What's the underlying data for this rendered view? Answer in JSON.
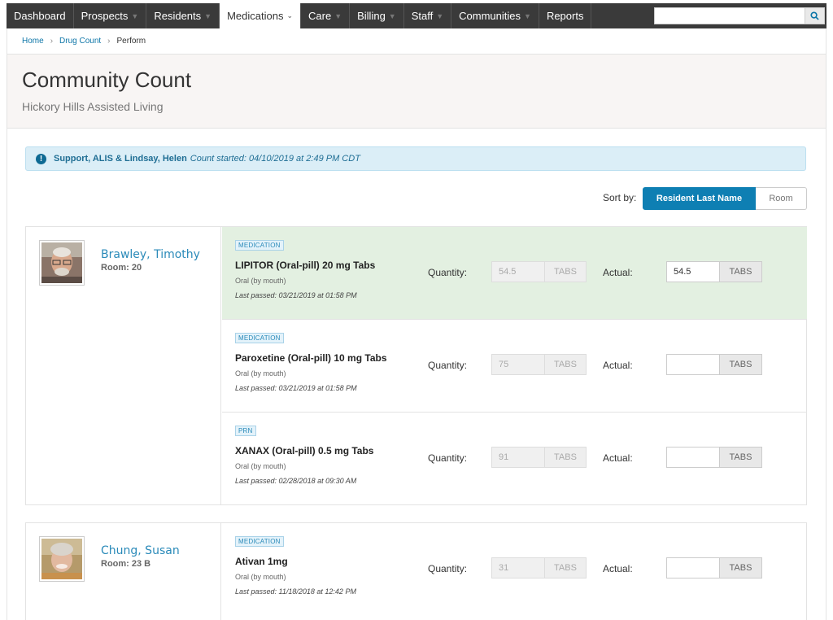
{
  "nav": {
    "items": [
      {
        "label": "Dashboard",
        "caret": false,
        "active": false
      },
      {
        "label": "Prospects",
        "caret": true,
        "active": false
      },
      {
        "label": "Residents",
        "caret": true,
        "active": false
      },
      {
        "label": "Medications",
        "caret": true,
        "active": true
      },
      {
        "label": "Care",
        "caret": true,
        "active": false
      },
      {
        "label": "Billing",
        "caret": true,
        "active": false
      },
      {
        "label": "Staff",
        "caret": true,
        "active": false
      },
      {
        "label": "Communities",
        "caret": true,
        "active": false
      },
      {
        "label": "Reports",
        "caret": false,
        "active": false
      }
    ],
    "search_placeholder": "",
    "search_icon": "search-icon"
  },
  "breadcrumb": {
    "home": "Home",
    "drug_count": "Drug Count",
    "current": "Perform"
  },
  "header": {
    "title": "Community Count",
    "subtitle": "Hickory Hills Assisted Living"
  },
  "alert": {
    "people": "Support, ALIS & Lindsay, Helen",
    "started": "Count started: 04/10/2019 at 2:49 PM CDT"
  },
  "sort": {
    "label": "Sort by:",
    "primary": "Resident Last Name",
    "secondary": "Room"
  },
  "labels": {
    "quantity": "Quantity:",
    "actual": "Actual:"
  },
  "residents": [
    {
      "name": "Brawley, Timothy",
      "room": "Room: 20",
      "meds": [
        {
          "tag": "MEDICATION",
          "name": "LIPITOR (Oral-pill) 20 mg Tabs",
          "route": "Oral (by mouth)",
          "last": "Last passed: 03/21/2019 at 01:58 PM",
          "qty": "54.5",
          "unit": "TABS",
          "actual": "54.5",
          "actual_unit": "TABS",
          "highlight": true
        },
        {
          "tag": "MEDICATION",
          "name": "Paroxetine (Oral-pill) 10 mg Tabs",
          "route": "Oral (by mouth)",
          "last": "Last passed: 03/21/2019 at 01:58 PM",
          "qty": "75",
          "unit": "TABS",
          "actual": "",
          "actual_unit": "TABS",
          "highlight": false
        },
        {
          "tag": "PRN",
          "name": "XANAX (Oral-pill) 0.5 mg Tabs",
          "route": "Oral (by mouth)",
          "last": "Last passed: 02/28/2018 at 09:30 AM",
          "qty": "91",
          "unit": "TABS",
          "actual": "",
          "actual_unit": "TABS",
          "highlight": false
        }
      ]
    },
    {
      "name": "Chung, Susan",
      "room": "Room: 23 B",
      "meds": [
        {
          "tag": "MEDICATION",
          "name": "Ativan 1mg",
          "route": "Oral (by mouth)",
          "last": "Last passed: 11/18/2018 at 12:42 PM",
          "qty": "31",
          "unit": "TABS",
          "actual": "",
          "actual_unit": "TABS",
          "highlight": false
        }
      ]
    }
  ]
}
